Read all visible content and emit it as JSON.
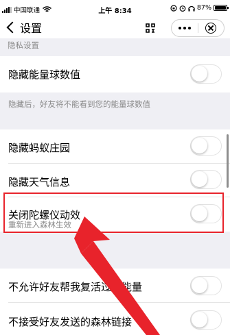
{
  "status_bar": {
    "carrier": "中国联通",
    "time": "上午 8:34",
    "battery": "87%",
    "battery_level": 0.87
  },
  "nav": {
    "title": "设置"
  },
  "sections": {
    "privacy_header": "隐私设置",
    "hide_energy": "隐藏能量球数值",
    "hide_energy_hint": "隐藏后，好友将不能看到您的能量球数值",
    "hide_manor": "隐藏蚂蚁庄园",
    "hide_weather": "隐藏天气信息",
    "gyro": "关闭陀螺仪动效",
    "gyro_hint": "重新进入森林生效",
    "no_revive": "不允许好友帮我复活过期能量",
    "no_receive": "不接受好友发送的森林链接"
  },
  "icons": [
    "back-chevron-icon",
    "scan-icon",
    "more-icon",
    "close-icon",
    "wifi-icon",
    "signal-icon",
    "battery-icon",
    "lock-rotation-icon",
    "alarm-icon",
    "headphones-icon",
    "arrow-annotation-icon"
  ],
  "colors": {
    "highlight": "#e8232b"
  }
}
